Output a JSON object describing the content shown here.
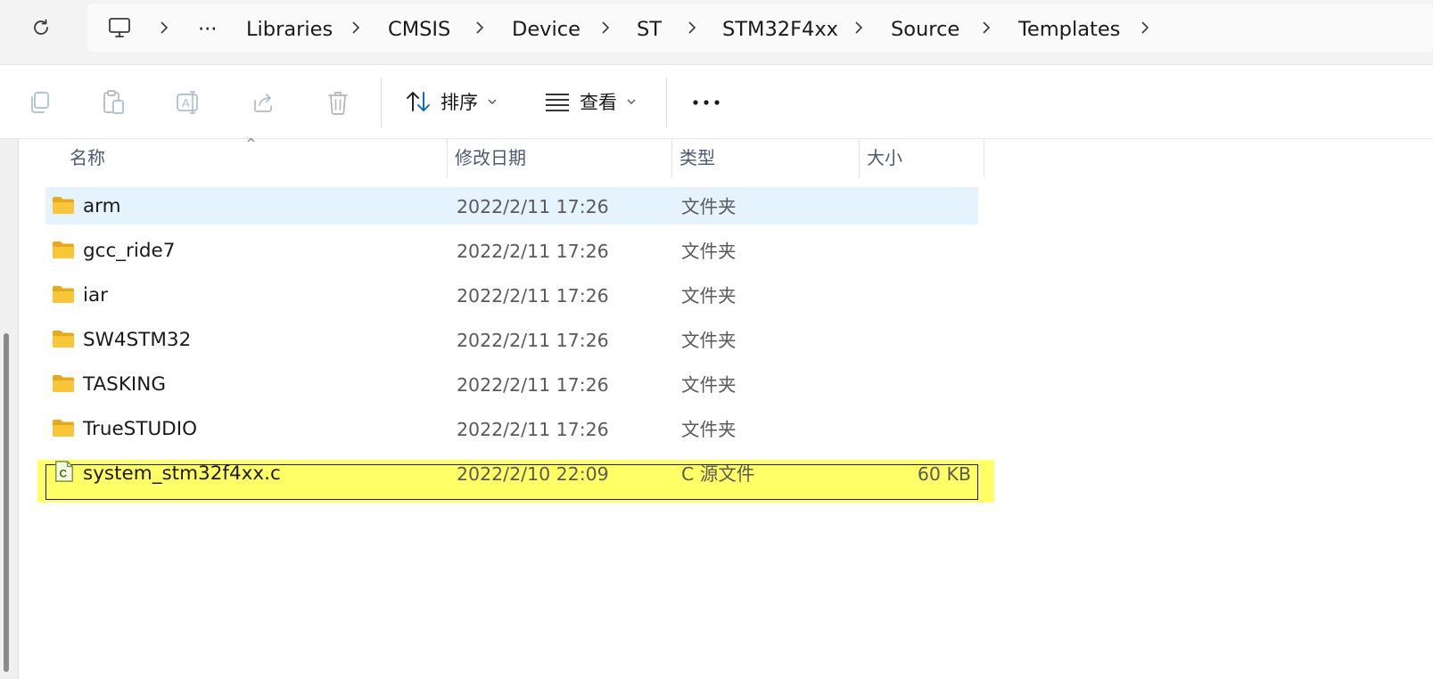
{
  "breadcrumb": {
    "overflow_label": "···",
    "items": [
      "Libraries",
      "CMSIS",
      "Device",
      "ST",
      "STM32F4xx",
      "Source",
      "Templates"
    ]
  },
  "toolbar": {
    "sort_label": "排序",
    "view_label": "查看",
    "more_label": "···"
  },
  "columns": {
    "name": "名称",
    "modified": "修改日期",
    "type": "类型",
    "size": "大小"
  },
  "files": [
    {
      "name": "arm",
      "modified": "2022/2/11 17:26",
      "type": "文件夹",
      "size": "",
      "icon": "folder-icon",
      "selected": true
    },
    {
      "name": "gcc_ride7",
      "modified": "2022/2/11 17:26",
      "type": "文件夹",
      "size": "",
      "icon": "folder-icon"
    },
    {
      "name": "iar",
      "modified": "2022/2/11 17:26",
      "type": "文件夹",
      "size": "",
      "icon": "folder-icon"
    },
    {
      "name": "SW4STM32",
      "modified": "2022/2/11 17:26",
      "type": "文件夹",
      "size": "",
      "icon": "folder-icon"
    },
    {
      "name": "TASKING",
      "modified": "2022/2/11 17:26",
      "type": "文件夹",
      "size": "",
      "icon": "folder-icon"
    },
    {
      "name": "TrueSTUDIO",
      "modified": "2022/2/11 17:26",
      "type": "文件夹",
      "size": "",
      "icon": "folder-icon"
    },
    {
      "name": "system_stm32f4xx.c",
      "modified": "2022/2/10 22:09",
      "type": "C 源文件",
      "size": "60 KB",
      "icon": "c-file-icon",
      "highlighted": true
    }
  ],
  "colors": {
    "selection": "#e5f3ff",
    "highlight": "#ffff66",
    "folder": "#f8c637",
    "accent": "#0067c0"
  }
}
